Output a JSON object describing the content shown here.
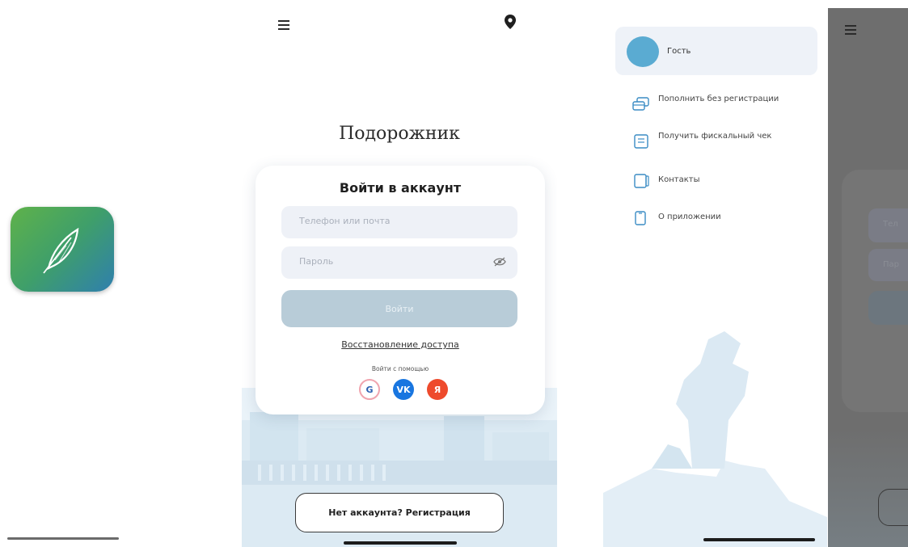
{
  "splash": {
    "icon": "feather-icon",
    "brand_color_start": "#5fb24a",
    "brand_color_end": "#2f7fae"
  },
  "login": {
    "brand": "Подорожник",
    "heading": "Войти в аккаунт",
    "phone_placeholder": "Телефон или почта",
    "password_placeholder": "Пароль",
    "login_button": "Войти",
    "recover_link": "Восстановление доступа",
    "login_with": "Войти с помощью",
    "social": [
      {
        "name": "gosuslugi-icon",
        "glyph": "G"
      },
      {
        "name": "vk-icon",
        "glyph": "VK"
      },
      {
        "name": "yandex-icon",
        "glyph": "Я"
      }
    ],
    "register_button": "Нет аккаунта? Регистрация",
    "button_color": "#b8ccd8"
  },
  "menu": {
    "guest_label": "Гость",
    "avatar_color": "#5aabd2",
    "items": [
      {
        "label": "Пополнить без регистрации",
        "icon": "cards-icon"
      },
      {
        "label": "Получить фискальный чек",
        "icon": "receipt-icon"
      },
      {
        "label": "Контакты",
        "icon": "contacts-icon"
      },
      {
        "label": "О приложении",
        "icon": "info-icon"
      }
    ]
  },
  "dimmed": {
    "phone_placeholder": "Тел",
    "password_placeholder": "Пар"
  }
}
